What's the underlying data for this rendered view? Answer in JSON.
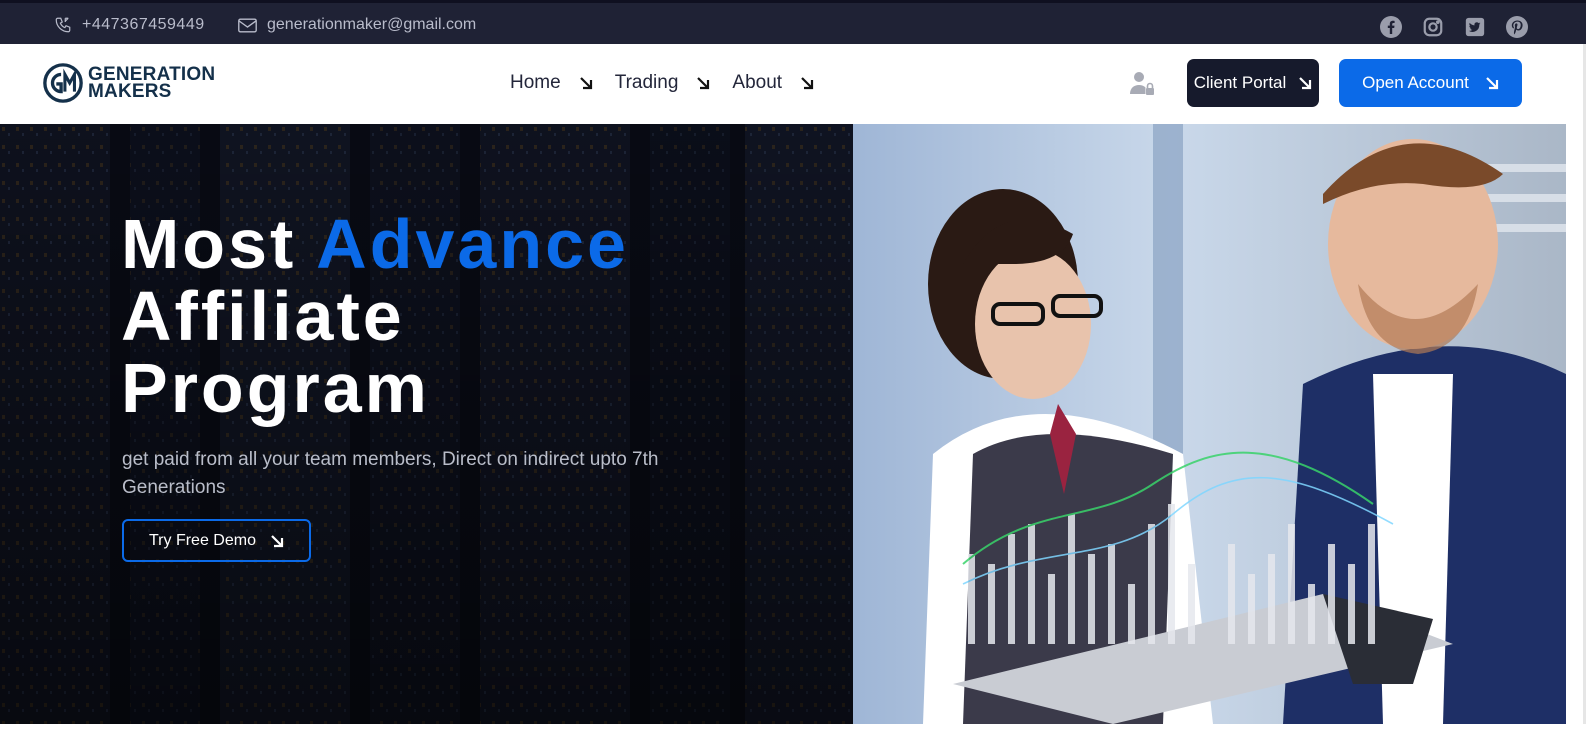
{
  "topbar": {
    "phone": "+447367459449",
    "email": "generationmaker@gmail.com",
    "social": [
      "facebook-icon",
      "instagram-icon",
      "twitter-icon",
      "pinterest-icon"
    ]
  },
  "brand": {
    "line1": "GENERATION",
    "line2": "MAKERS",
    "color": "#14304a"
  },
  "nav": {
    "items": [
      {
        "label": "Home"
      },
      {
        "label": "Trading"
      },
      {
        "label": "About"
      }
    ],
    "client_portal": "Client Portal",
    "open_account": "Open Account"
  },
  "hero": {
    "headline_word1": "Most",
    "headline_accent": "Advance",
    "headline_line2": "Affiliate",
    "headline_line3": "Program",
    "subtext": "get paid from all your team members, Direct on indirect upto 7th Generations",
    "cta": "Try Free Demo"
  },
  "colors": {
    "accent": "#0b6ae8",
    "dark": "#161a2c",
    "topbar": "#1f2235"
  }
}
